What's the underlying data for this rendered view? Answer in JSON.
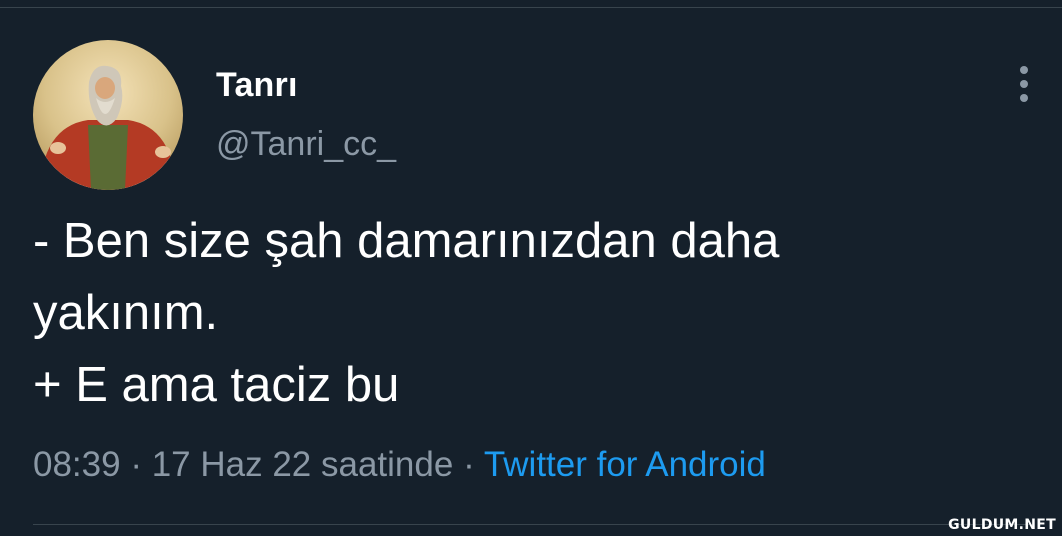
{
  "tweet": {
    "display_name": "Tanrı",
    "handle": "@Tanri_cc_",
    "text": "- Ben size şah damarınızdan daha\nyakınım.\n+ E ama taciz bu",
    "time": "08:39",
    "date": "17 Haz 22 saatinde",
    "separator": "·",
    "source": "Twitter for Android"
  },
  "icons": {
    "more": "more-vertical-icon",
    "avatar": "avatar"
  },
  "watermark": "GULDUM.NET",
  "colors": {
    "background": "#15202b",
    "text": "#ffffff",
    "secondary": "#8b98a5",
    "link": "#1d9bf0",
    "divider": "#38444d"
  }
}
